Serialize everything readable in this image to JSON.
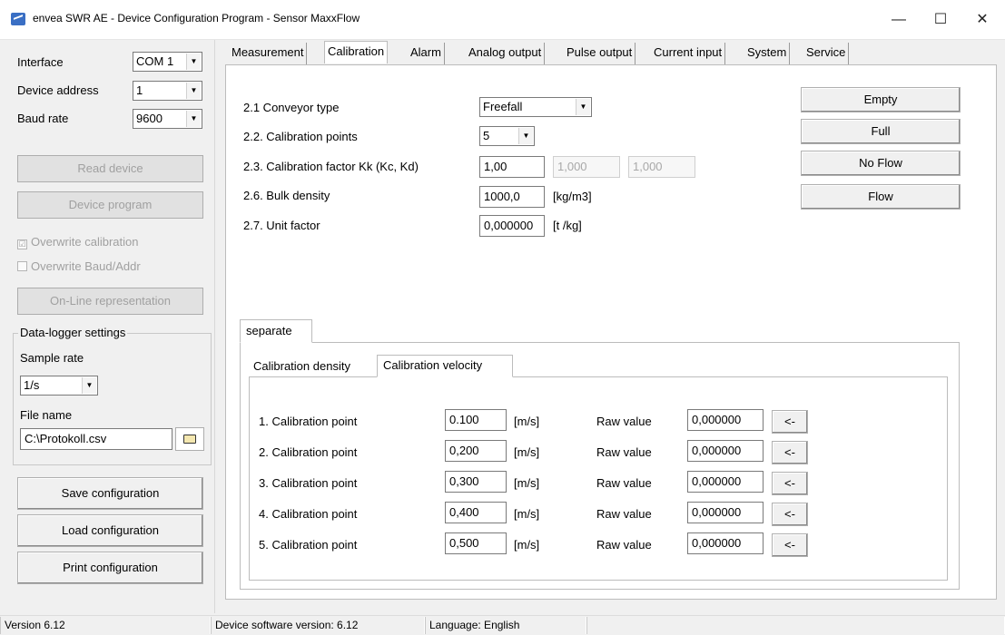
{
  "window": {
    "title": "envea SWR AE - Device Configuration Program - Sensor MaxxFlow",
    "minimize": "—",
    "maximize": "☐",
    "close": "✕"
  },
  "left": {
    "interface_label": "Interface",
    "interface_value": "COM 1",
    "address_label": "Device address",
    "address_value": "1",
    "baud_label": "Baud rate",
    "baud_value": "9600",
    "read_device": "Read device",
    "device_program": "Device program",
    "overwrite_calibration": "Overwrite calibration",
    "overwrite_calibration_checked": "☑",
    "overwrite_baud": "Overwrite Baud/Addr",
    "online": "On-Line representation",
    "datalogger_title": "Data-logger settings",
    "sample_rate_label": "Sample rate",
    "sample_rate_value": "1/s",
    "file_name_label": "File name",
    "file_name_value": "C:\\Protokoll.csv",
    "save_config": "Save configuration",
    "load_config": "Load configuration",
    "print_config": "Print configuration"
  },
  "tabs": [
    "Measurement",
    "Calibration",
    "Alarm",
    "Analog output",
    "Pulse output",
    "Current input",
    "System",
    "Service"
  ],
  "calibration": {
    "conveyor_label": "2.1 Conveyor type",
    "conveyor_value": "Freefall",
    "points_label": "2.2. Calibration points",
    "points_value": "5",
    "factor_label": "2.3. Calibration factor Kk (Kc, Kd)",
    "factor_kk": "1,00",
    "factor_kc": "1,000",
    "factor_kd": "1,000",
    "density_label": "2.6. Bulk density",
    "density_value": "1000,0",
    "density_unit": "[kg/m3]",
    "unit_factor_label": "2.7. Unit factor",
    "unit_factor_value": "0,000000",
    "unit_factor_unit": "[t  /kg]",
    "btn_empty": "Empty",
    "btn_full": "Full",
    "btn_noflow": "No Flow",
    "btn_flow": "Flow",
    "separate_tab": "separate",
    "sub_tabs": [
      "Calibration density",
      "Calibration velocity"
    ],
    "raw_label": "Raw value",
    "unit": "[m/s]",
    "arrow": "<-",
    "points": [
      {
        "label": "1. Calibration point",
        "value": "0.100",
        "raw": "0,000000"
      },
      {
        "label": "2. Calibration point",
        "value": "0,200",
        "raw": "0,000000"
      },
      {
        "label": "3. Calibration point",
        "value": "0,300",
        "raw": "0,000000"
      },
      {
        "label": "4. Calibration point",
        "value": "0,400",
        "raw": "0,000000"
      },
      {
        "label": "5. Calibration point",
        "value": "0,500",
        "raw": "0,000000"
      }
    ]
  },
  "status": {
    "version": "Version 6.12",
    "device_sw": "Device software version: 6.12",
    "language": "Language: English"
  }
}
